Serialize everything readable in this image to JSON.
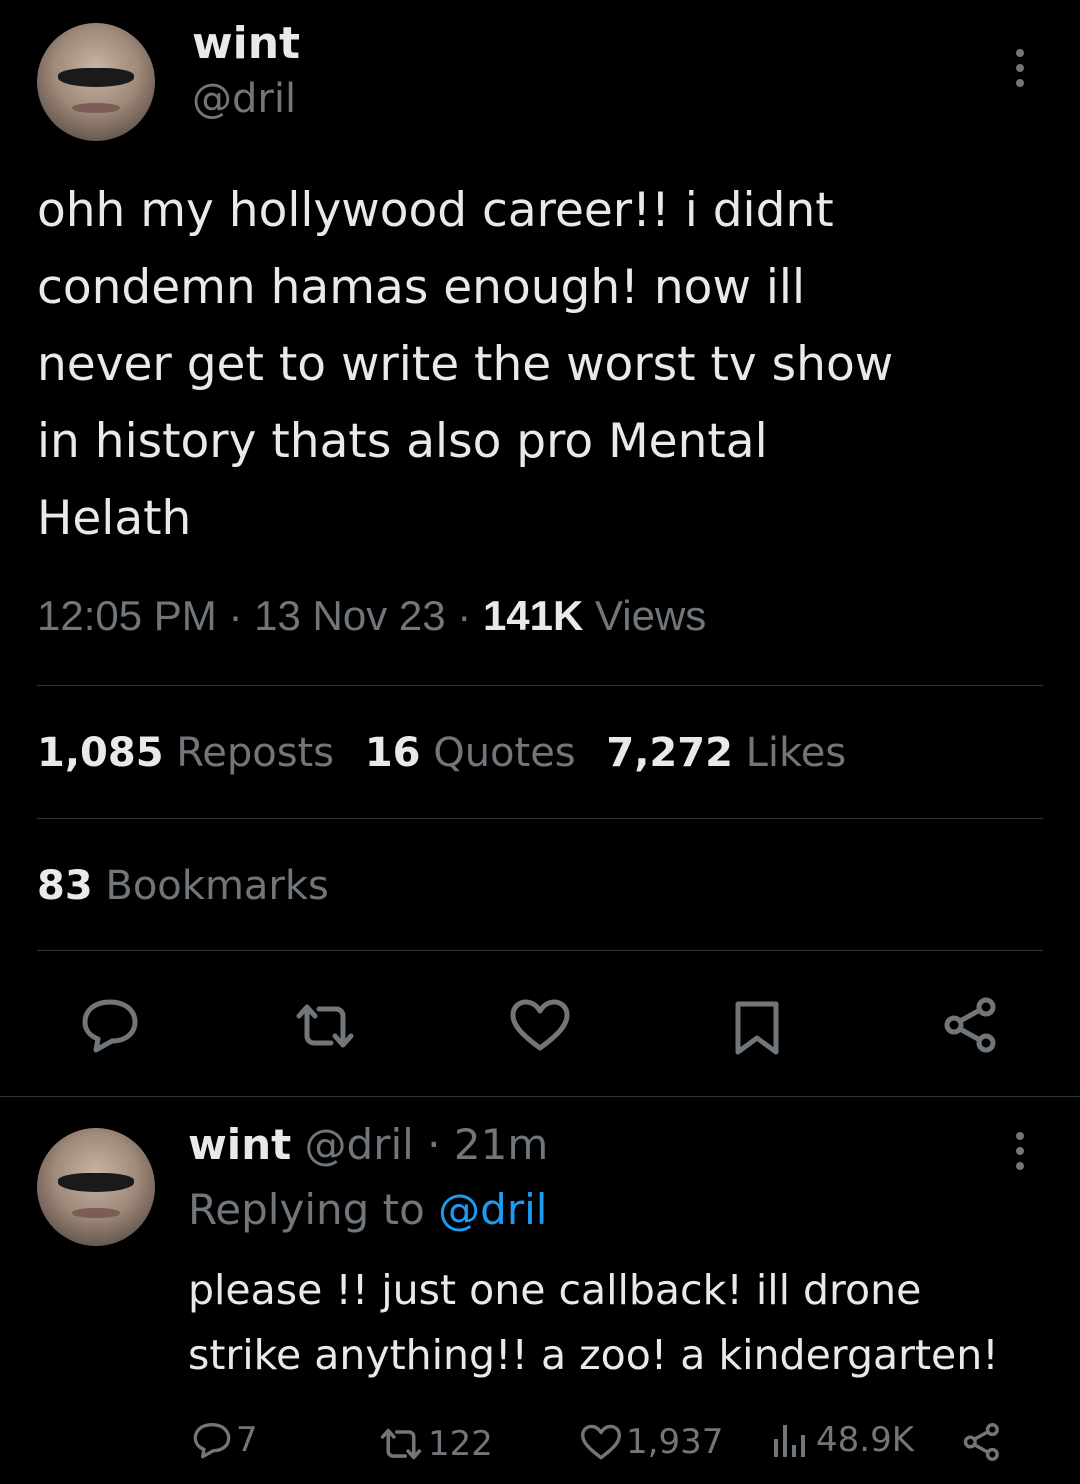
{
  "tweet": {
    "display_name": "wint",
    "handle": "@dril",
    "text_lines": [
      "ohh my hollywood career!! i didnt",
      "condemn hamas enough! now ill",
      "never get to write the worst tv show",
      "in history thats also pro Mental",
      "Helath"
    ],
    "time": "12:05 PM",
    "sep1": "·",
    "date": "13 Nov 23",
    "sep2": "·",
    "views_count": "141K",
    "views_label": "Views",
    "stats": {
      "reposts_count": "1,085",
      "reposts_label": "Reposts",
      "quotes_count": "16",
      "quotes_label": "Quotes",
      "likes_count": "7,272",
      "likes_label": "Likes",
      "bookmarks_count": "83",
      "bookmarks_label": "Bookmarks"
    },
    "actions": [
      "reply-icon",
      "repost-icon",
      "like-icon",
      "bookmark-icon",
      "share-icon"
    ]
  },
  "reply": {
    "display_name": "wint",
    "handle": "@dril",
    "sep": "·",
    "age": "21m",
    "replying_label": "Replying to",
    "replying_handle": "@dril",
    "text_lines": [
      "please !! just one callback! ill drone",
      "strike anything!! a zoo! a kindergarten!"
    ],
    "counts": {
      "replies": "7",
      "reposts": "122",
      "likes": "1,937",
      "views": "48.9K"
    }
  },
  "colors": {
    "background": "#000000",
    "text": "#e7e9ea",
    "muted": "#71767b",
    "divider": "#2f3336",
    "link": "#1d9bf0"
  }
}
